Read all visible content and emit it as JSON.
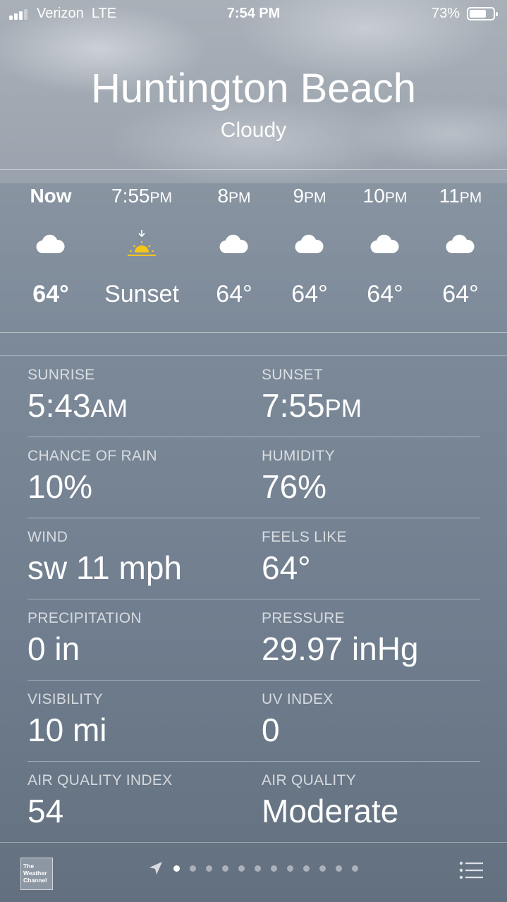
{
  "status_bar": {
    "carrier": "Verizon",
    "network": "LTE",
    "time": "7:54 PM",
    "battery_percent": "73%",
    "battery_level": 0.73
  },
  "location": {
    "city": "Huntington Beach",
    "condition": "Cloudy"
  },
  "hourly": [
    {
      "time": "Now",
      "suffix": "",
      "icon": "cloud-icon",
      "value": "64°"
    },
    {
      "time": "7:55",
      "suffix": "PM",
      "icon": "sunset-icon",
      "value": "Sunset"
    },
    {
      "time": "8",
      "suffix": "PM",
      "icon": "cloud-icon",
      "value": "64°"
    },
    {
      "time": "9",
      "suffix": "PM",
      "icon": "cloud-icon",
      "value": "64°"
    },
    {
      "time": "10",
      "suffix": "PM",
      "icon": "cloud-icon",
      "value": "64°"
    },
    {
      "time": "11",
      "suffix": "PM",
      "icon": "cloud-icon",
      "value": "64°"
    }
  ],
  "details": [
    {
      "label": "SUNRISE",
      "value": "5:43",
      "suffix": "AM"
    },
    {
      "label": "SUNSET",
      "value": "7:55",
      "suffix": "PM"
    },
    {
      "label": "CHANCE OF RAIN",
      "value": "10%",
      "suffix": ""
    },
    {
      "label": "HUMIDITY",
      "value": "76%",
      "suffix": ""
    },
    {
      "label": "WIND",
      "value": "sw 11 mph",
      "suffix": ""
    },
    {
      "label": "FEELS LIKE",
      "value": "64°",
      "suffix": ""
    },
    {
      "label": "PRECIPITATION",
      "value": "0 in",
      "suffix": ""
    },
    {
      "label": "PRESSURE",
      "value": "29.97 inHg",
      "suffix": ""
    },
    {
      "label": "VISIBILITY",
      "value": "10 mi",
      "suffix": ""
    },
    {
      "label": "UV INDEX",
      "value": "0",
      "suffix": ""
    },
    {
      "label": "AIR QUALITY INDEX",
      "value": "54",
      "suffix": ""
    },
    {
      "label": "AIR QUALITY",
      "value": "Moderate",
      "suffix": ""
    }
  ],
  "bottom_bar": {
    "logo_text": [
      "The",
      "Weather",
      "Channel"
    ],
    "page_count": 12,
    "current_page": 1
  },
  "colors": {
    "sun": "#f5c518"
  }
}
